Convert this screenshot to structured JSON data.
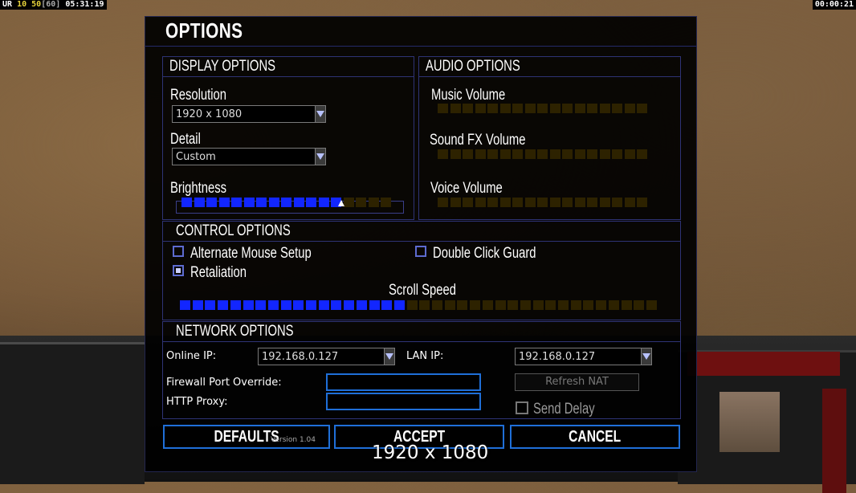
{
  "hud": {
    "left_prefix": "UR",
    "left_a": "10",
    "left_b": "50",
    "left_c": "[60]",
    "left_time": "05:31:19",
    "right_time": "00:00:21"
  },
  "dialog": {
    "title": "OPTIONS"
  },
  "display": {
    "header": "DISPLAY OPTIONS",
    "resolution_label": "Resolution",
    "resolution_value": "1920 x 1080",
    "detail_label": "Detail",
    "detail_value": "Custom",
    "brightness_label": "Brightness",
    "brightness_level": 13,
    "brightness_total": 17
  },
  "audio": {
    "header": "AUDIO OPTIONS",
    "music_label": "Music Volume",
    "sfx_label": "Sound FX Volume",
    "voice_label": "Voice Volume",
    "music_level": 0,
    "sfx_level": 0,
    "voice_level": 0,
    "total": 17
  },
  "control": {
    "header": "CONTROL OPTIONS",
    "alt_mouse_label": "Alternate Mouse Setup",
    "alt_mouse_checked": false,
    "double_click_label": "Double Click Guard",
    "double_click_checked": false,
    "retaliation_label": "Retaliation",
    "retaliation_checked": true,
    "scroll_label": "Scroll Speed",
    "scroll_level": 18,
    "scroll_total": 38
  },
  "network": {
    "header": "NETWORK OPTIONS",
    "online_ip_label": "Online IP:",
    "online_ip_value": "192.168.0.127",
    "lan_ip_label": "LAN IP:",
    "lan_ip_value": "192.168.0.127",
    "firewall_label": "Firewall Port Override:",
    "firewall_value": "",
    "proxy_label": "HTTP Proxy:",
    "proxy_value": "",
    "refresh_nat_label": "Refresh NAT",
    "send_delay_label": "Send Delay",
    "send_delay_checked": false
  },
  "buttons": {
    "defaults": "DEFAULTS",
    "accept": "ACCEPT",
    "cancel": "CANCEL"
  },
  "version": "Version 1.04",
  "overlay_resolution": "1920 x 1080",
  "colors": {
    "segment_on": "#1226ff",
    "segment_off": "#2d2200",
    "panel_border": "#2e3375",
    "button_border": "#1f6fd8"
  }
}
